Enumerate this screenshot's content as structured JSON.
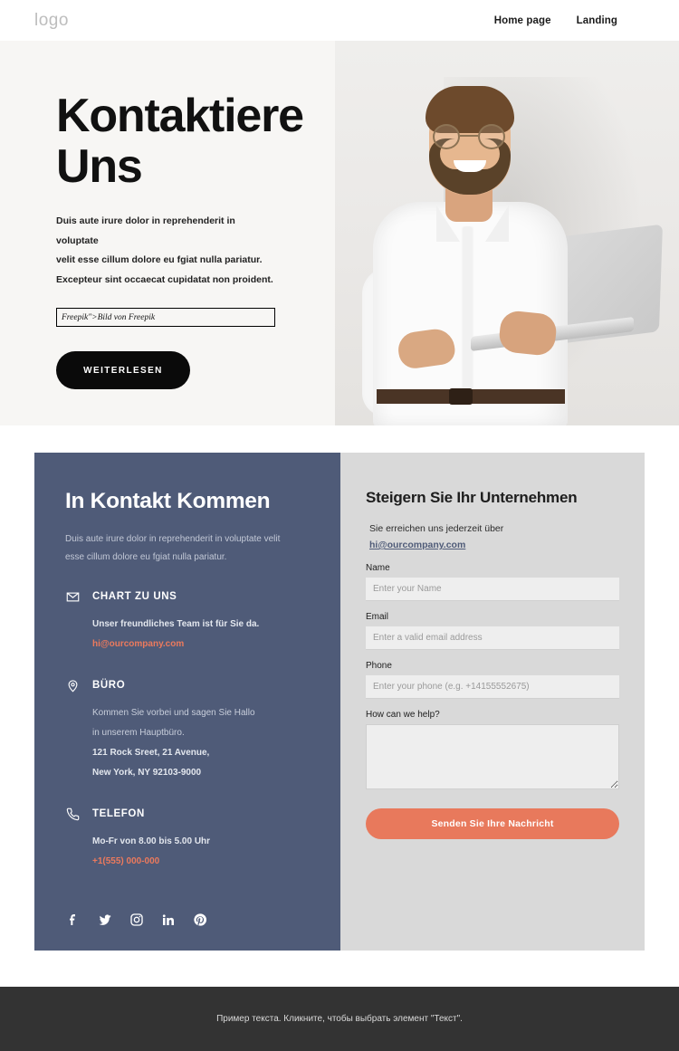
{
  "header": {
    "logo": "logo",
    "nav": [
      {
        "label": "Home page"
      },
      {
        "label": "Landing"
      }
    ]
  },
  "hero": {
    "title": "Kontaktiere Uns",
    "paragraph_lines": [
      "Duis aute irure dolor in reprehenderit in voluptate",
      "velit esse cillum dolore eu fgiat nulla pariatur.",
      "Excepteur sint occaecat cupidatat non proident."
    ],
    "attribution": "Freepik\">Bild von Freepik",
    "button_label": "WEITERLESEN",
    "image_alt": "smiling bearded man with glasses in white shirt holding a laptop"
  },
  "contact_panel": {
    "title": "In Kontakt Kommen",
    "intro_lines": [
      "Duis aute irure dolor in reprehenderit in voluptate velit",
      "esse cillum dolore eu fgiat nulla pariatur."
    ],
    "blocks": [
      {
        "icon": "envelope-icon",
        "label": "CHART ZU UNS",
        "lines": [
          "Unser freundliches Team ist für Sie da."
        ],
        "link": "hi@ourcompany.com"
      },
      {
        "icon": "map-pin-icon",
        "label": "BÜRO",
        "lines": [
          "Kommen Sie vorbei und sagen Sie Hallo",
          "in unserem Hauptbüro.",
          "121 Rock Sreet, 21 Avenue,",
          "New York, NY 92103-9000"
        ],
        "link": ""
      },
      {
        "icon": "phone-icon",
        "label": "TELEFON",
        "lines": [
          "Mo-Fr von 8.00 bis 5.00 Uhr"
        ],
        "link": "+1(555) 000-000"
      }
    ],
    "social": [
      {
        "name": "facebook-icon"
      },
      {
        "name": "twitter-icon"
      },
      {
        "name": "instagram-icon"
      },
      {
        "name": "linkedin-icon"
      },
      {
        "name": "pinterest-icon"
      }
    ]
  },
  "form": {
    "title": "Steigern Sie Ihr Unternehmen",
    "subtitle": "Sie erreichen uns jederzeit über",
    "email_link": "hi@ourcompany.com",
    "fields": [
      {
        "label": "Name",
        "placeholder": "Enter your Name",
        "value": "",
        "type": "text"
      },
      {
        "label": "Email",
        "placeholder": "Enter a valid email address",
        "value": "",
        "type": "text"
      },
      {
        "label": "Phone",
        "placeholder": "Enter your phone (e.g. +14155552675)",
        "value": "",
        "type": "text"
      },
      {
        "label": "How can we help?",
        "placeholder": "",
        "value": "",
        "type": "textarea"
      }
    ],
    "submit_label": "Senden Sie Ihre Nachricht"
  },
  "footer": {
    "text": "Пример текста. Кликните, чтобы выбрать элемент \"Текст\"."
  },
  "colors": {
    "panel_blue": "#4f5b78",
    "accent_coral": "#e8795c",
    "link_coral": "#ec7a5d",
    "hero_bg": "#f7f6f4",
    "form_bg": "#d9d9d9",
    "footer_bg": "#333333",
    "button_black": "#0a0a0a"
  }
}
